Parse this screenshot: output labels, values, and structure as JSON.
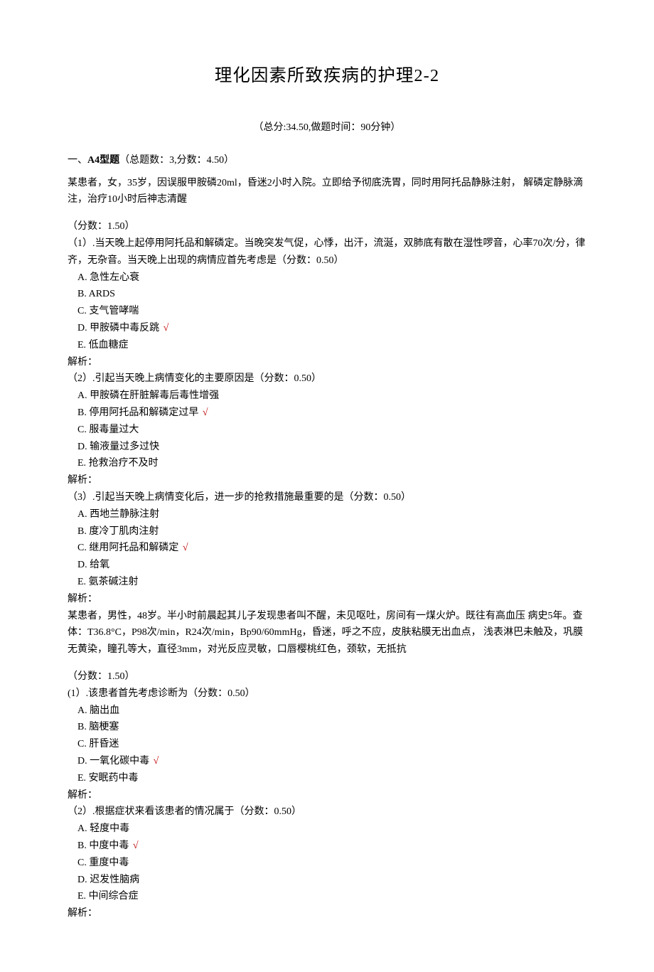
{
  "title": "理化因素所致疾病的护理2-2",
  "meta": "（总分:34.50,做题时间：90分钟）",
  "section": {
    "prefix": "一、",
    "label": "A4型题",
    "stats": "（总题数：3,分数：4.50）"
  },
  "correct_mark": "√",
  "jiexi_label": "解析：",
  "cases": [
    {
      "intro": "某患者，女，35岁，因误服甲胺磷20ml，昏迷2小时入院。立即给予彻底洗胃，同时用阿托品静脉注射， 解磷定静脉滴注，治疗10小时后神志清醒",
      "score": "（分数：1.50）",
      "questions": [
        {
          "stem": "（1）.当天晚上起停用阿托品和解磷定。当晚突发气促，心悸，出汗，流涎，双肺底有散在湿性啰音，心率70次/分，律齐，无杂音。当天晚上出现的病情应首先考虑是（分数：0.50）",
          "options": [
            {
              "label": "A.",
              "text": "急性左心衰",
              "correct": false
            },
            {
              "label": "B.",
              "text": "ARDS",
              "correct": false
            },
            {
              "label": "C.",
              "text": "支气管哮喘",
              "correct": false
            },
            {
              "label": "D.",
              "text": "甲胺磷中毒反跳",
              "correct": true
            },
            {
              "label": "E.",
              "text": "低血糖症",
              "correct": false
            }
          ]
        },
        {
          "stem": "（2）.引起当天晚上病情变化的主要原因是（分数：0.50）",
          "options": [
            {
              "label": "A.",
              "text": "甲胺磷在肝脏解毒后毒性增强",
              "correct": false
            },
            {
              "label": "B.",
              "text": "停用阿托品和解磷定过早",
              "correct": true
            },
            {
              "label": "C.",
              "text": "服毒量过大",
              "correct": false
            },
            {
              "label": "D.",
              "text": "输液量过多过快",
              "correct": false
            },
            {
              "label": "E.",
              "text": "抢救治疗不及时",
              "correct": false
            }
          ]
        },
        {
          "stem": "（3）.引起当天晚上病情变化后，进一步的抢救措施最重要的是（分数：0.50）",
          "options": [
            {
              "label": "A.",
              "text": "西地兰静脉注射",
              "correct": false
            },
            {
              "label": "B.",
              "text": "度冷丁肌肉注射",
              "correct": false
            },
            {
              "label": "C.",
              "text": "继用阿托品和解磷定",
              "correct": true
            },
            {
              "label": "D.",
              "text": "给氧",
              "correct": false
            },
            {
              "label": "E.",
              "text": "氨茶碱注射",
              "correct": false
            }
          ]
        }
      ]
    },
    {
      "intro": "某患者，男性，48岁。半小时前晨起其儿子发现患者叫不醒，未见呕吐，房间有一煤火炉。既往有高血压 病史5年。查体：T36.8°C，P98次/min，R24次/min，Bp90/60mmHg，昏迷，呼之不应，皮肤粘膜无出血点， 浅表淋巴未触及，巩膜无黄染，瞳孔等大，直径3mm，对光反应灵敏，口唇樱桃红色，颈软，无抵抗",
      "score": "（分数：1.50）",
      "questions": [
        {
          "stem": "(1）.该患者首先考虑诊断为（分数：0.50）",
          "options": [
            {
              "label": "A.",
              "text": "脑出血",
              "correct": false
            },
            {
              "label": "B.",
              "text": "脑梗塞",
              "correct": false
            },
            {
              "label": "C.",
              "text": "肝昏迷",
              "correct": false
            },
            {
              "label": "D.",
              "text": "一氧化碳中毒",
              "correct": true
            },
            {
              "label": "E.",
              "text": "安眠药中毒",
              "correct": false
            }
          ]
        },
        {
          "stem": "（2）.根据症状来看该患者的情况属于（分数：0.50）",
          "options": [
            {
              "label": "A.",
              "text": "轻度中毒",
              "correct": false
            },
            {
              "label": "B.",
              "text": "中度中毒",
              "correct": true
            },
            {
              "label": "C.",
              "text": "重度中毒",
              "correct": false
            },
            {
              "label": "D.",
              "text": "迟发性脑病",
              "correct": false
            },
            {
              "label": "E.",
              "text": "中间综合症",
              "correct": false
            }
          ]
        }
      ]
    }
  ]
}
